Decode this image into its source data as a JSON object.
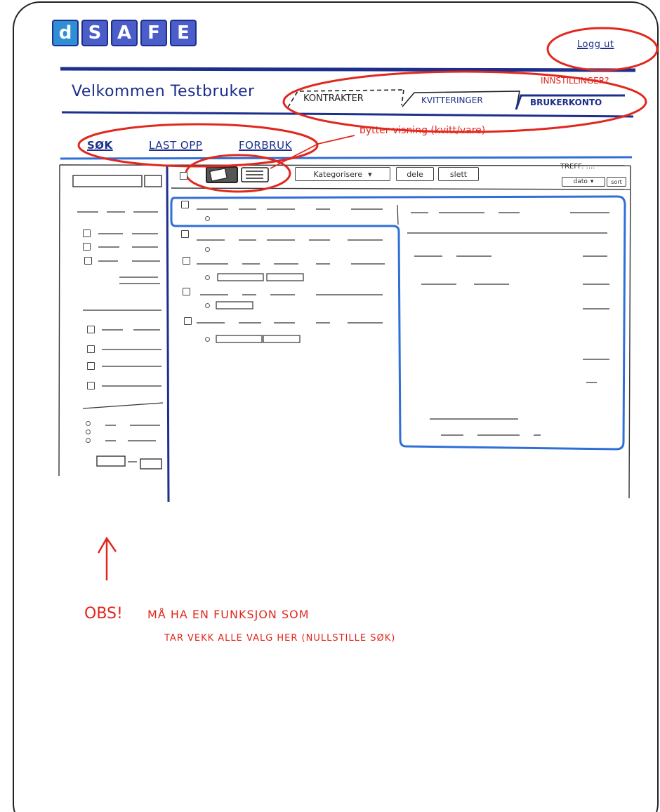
{
  "logo": {
    "letters": [
      "d",
      "S",
      "A",
      "F",
      "E"
    ],
    "color": "#4a5dc9"
  },
  "header": {
    "logout_label": "Logg ut"
  },
  "welcome": "Velkommen Testbruker",
  "tabs": [
    {
      "label": "KONTRAKTER"
    },
    {
      "label": "KVITTERINGER"
    },
    {
      "label": "BRUKERKONTO"
    }
  ],
  "subnav": [
    {
      "label": "SØK",
      "active": true
    },
    {
      "label": "LAST OPP",
      "active": false
    },
    {
      "label": "FORBRUK",
      "active": false
    }
  ],
  "toolbar": {
    "categorize_label": "Kategorisere",
    "share_label": "dele",
    "delete_label": "slett",
    "hits_label": "TREFF: ....",
    "date_label": "dato",
    "sort_label": "sort",
    "view_toggle_icons": [
      "receipt-view-icon",
      "list-view-icon"
    ]
  },
  "annotations": {
    "settings_note": "INNSTILLINGER?",
    "view_note": "bytter visning (kvitt/vare)",
    "obs_title": "OBS!",
    "obs_line1": "MÅ HA EN FUNKSJON SOM",
    "obs_line2": "TAR VEKK ALLE VALG HER (NULLSTILLE SØK)"
  },
  "colors": {
    "ink_blue": "#1c2f8c",
    "annotation_red": "#e0281e",
    "highlight_blue": "#2f6fd6"
  }
}
